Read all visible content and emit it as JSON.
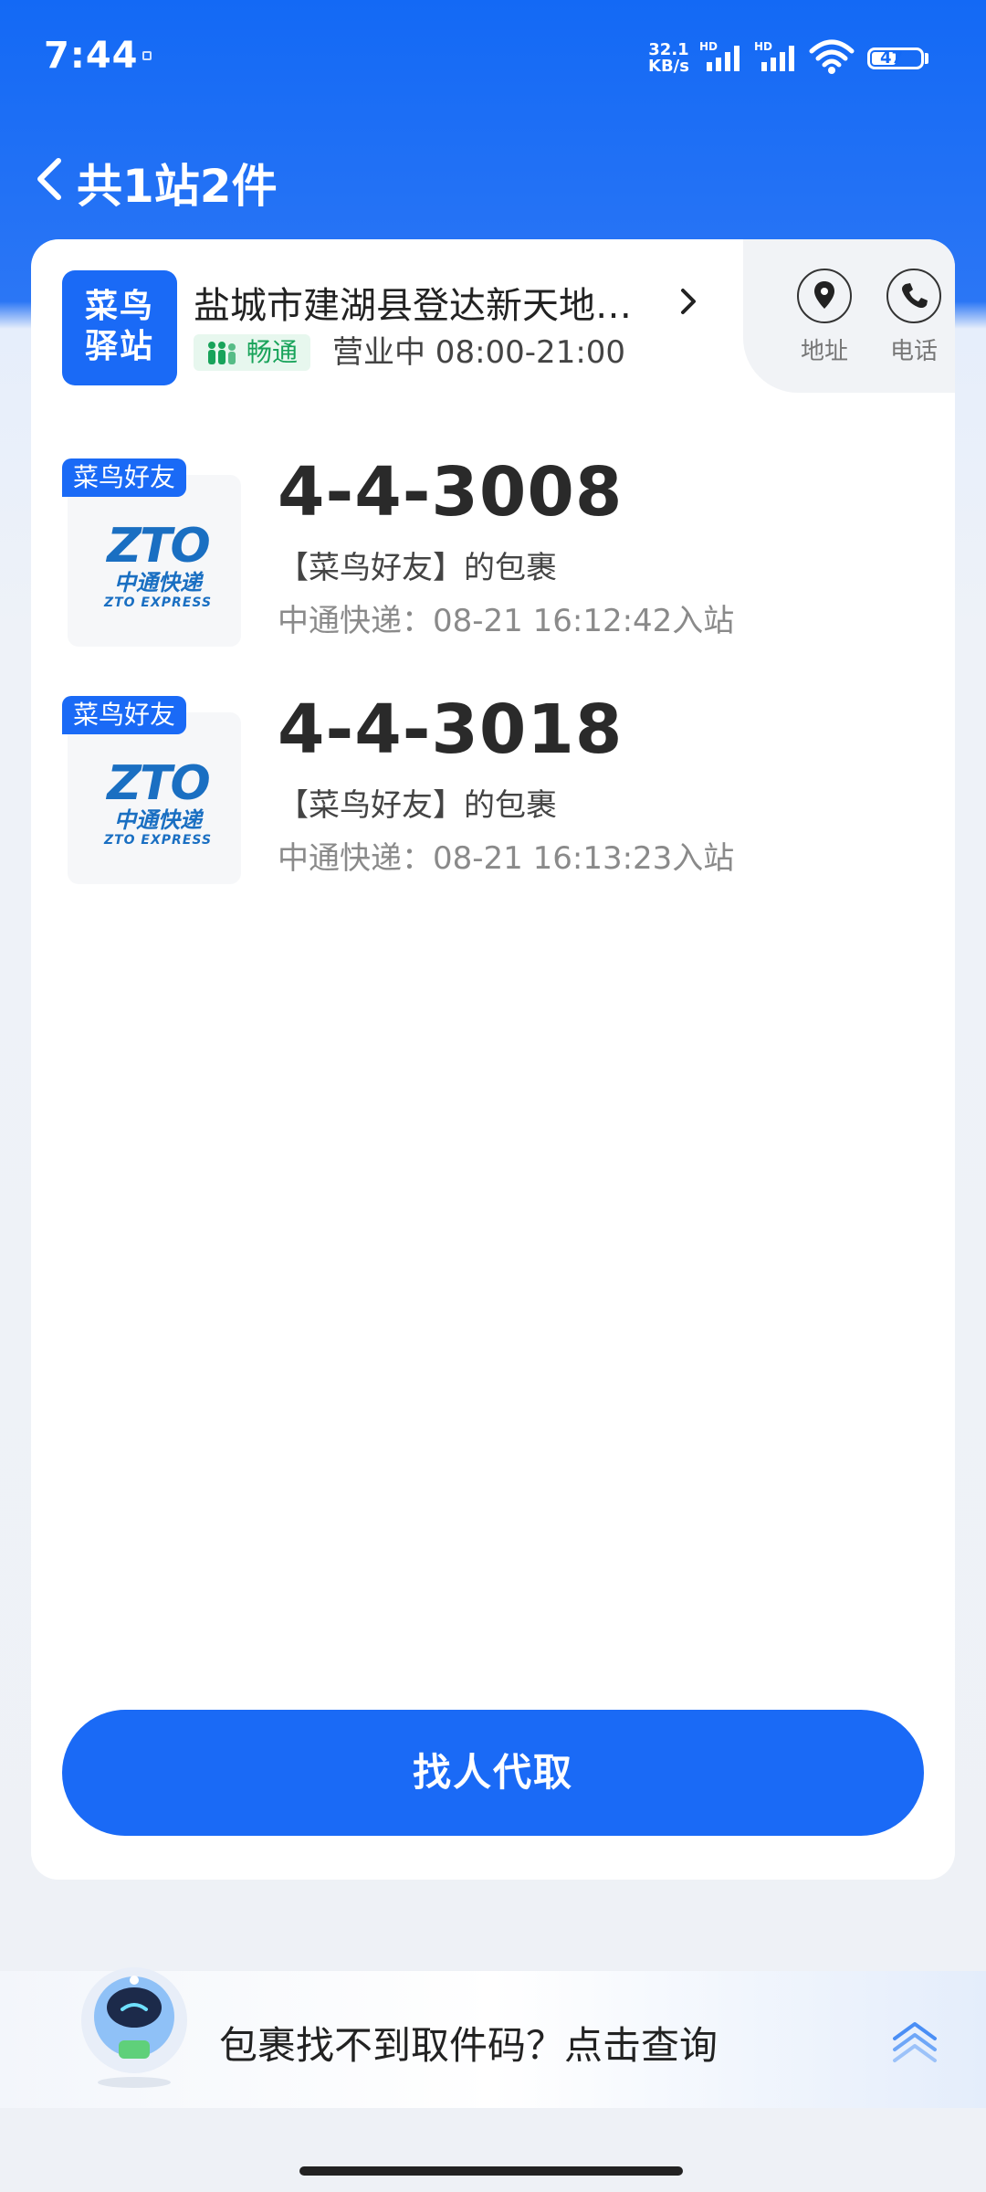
{
  "status_bar": {
    "time": "7:44",
    "net_speed_value": "32.1",
    "net_speed_unit": "KB/s",
    "hd_label": "HD",
    "battery": "47"
  },
  "header": {
    "title": "共1站2件"
  },
  "station": {
    "logo_line1": "菜鸟",
    "logo_line2": "驿站",
    "name": "盐城市建湖县登达新天地…",
    "status_tag": "畅通",
    "hours": "营业中 08:00-21:00",
    "address_label": "地址",
    "phone_label": "电话"
  },
  "packages": [
    {
      "badge": "菜鸟好友",
      "code": "4-4-3008",
      "owner": "【菜鸟好友】的包裹",
      "time": "中通快递：08-21 16:12:42入站",
      "logo_big": "ZTO",
      "logo_cn": "中通快递",
      "logo_en": "ZTO EXPRESS"
    },
    {
      "badge": "菜鸟好友",
      "code": "4-4-3018",
      "owner": "【菜鸟好友】的包裹",
      "time": "中通快递：08-21 16:13:23入站",
      "logo_big": "ZTO",
      "logo_cn": "中通快递",
      "logo_en": "ZTO EXPRESS"
    }
  ],
  "actions": {
    "proxy_pickup": "找人代取"
  },
  "helper": {
    "text": "包裹找不到取件码？点击查询"
  },
  "colors": {
    "brand_blue": "#1a6af6",
    "status_green": "#18a35a",
    "zto_blue": "#1a6fc2"
  }
}
